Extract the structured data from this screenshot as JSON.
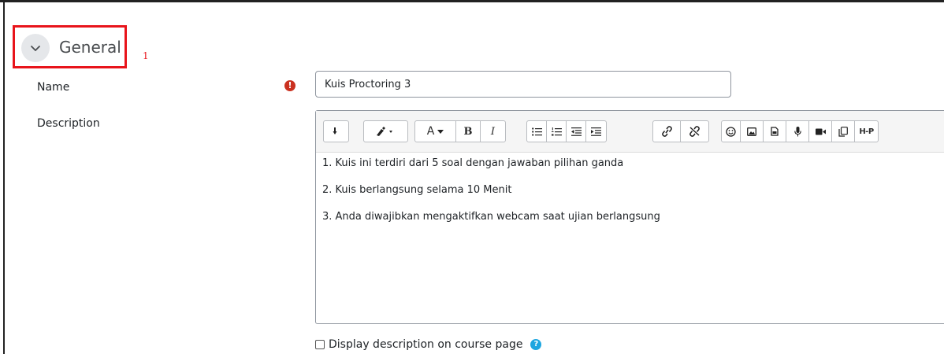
{
  "annotation": {
    "number": "1",
    "highlight_color": "#e8141b"
  },
  "section": {
    "title": "General",
    "icon": "chevron-down-icon"
  },
  "fields": {
    "name": {
      "label": "Name",
      "value": "Kuis Proctoring 3",
      "required_icon": "!"
    },
    "description": {
      "label": "Description"
    }
  },
  "editor": {
    "toolbar_icons": [
      "collapse-icon",
      "text-color-icon",
      "font-style-icon",
      "bold-icon",
      "italic-icon",
      "unordered-list-icon",
      "ordered-list-icon",
      "outdent-icon",
      "indent-icon",
      "link-icon",
      "unlink-icon",
      "emoji-icon",
      "image-icon",
      "media-file-icon",
      "record-audio-icon",
      "record-video-icon",
      "manage-files-icon",
      "h5p-icon"
    ],
    "font_label": "A",
    "bold_label": "B",
    "italic_label": "I",
    "h5p_label": "H-P",
    "content": [
      "1. Kuis ini terdiri dari 5 soal dengan jawaban pilihan ganda",
      "2. Kuis berlangsung selama 10 Menit",
      "3. Anda diwajibkan mengaktifkan webcam saat ujian berlangsung"
    ]
  },
  "display_description": {
    "label": "Display description on course page",
    "checked": false,
    "help_icon": "?"
  },
  "colors": {
    "required": "#ca3120",
    "help": "#1da6e0",
    "chevron_bg": "#e5e7ea"
  }
}
